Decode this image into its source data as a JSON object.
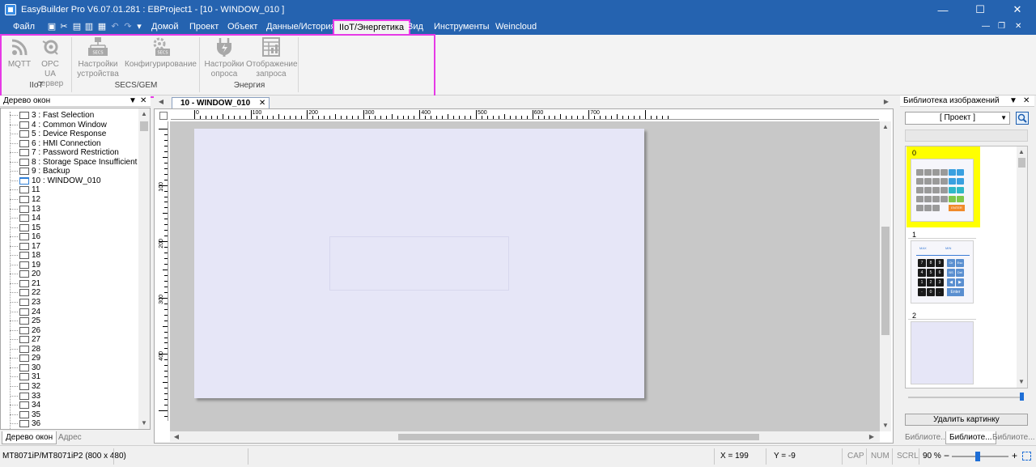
{
  "window": {
    "title": "EasyBuilder Pro V6.07.01.281 : EBProject1 - [10 - WINDOW_010 ]",
    "minimize": "—",
    "maximize": "☐",
    "close": "✕"
  },
  "menu": {
    "file": "Файл",
    "home": "Домой",
    "project": "Проект",
    "object": "Объект",
    "data_history": "Данные/История",
    "iiot_energy": "IIoT/Энергетика",
    "view": "Вид",
    "tools": "Инструменты",
    "weincloud": "Weincloud"
  },
  "ribbon": {
    "mqtt": "MQTT",
    "opcua_line1": "OPC UA",
    "opcua_line2": "сервер",
    "group_iiot": "IIoT",
    "dev_settings_line1": "Настройки",
    "dev_settings_line2": "устройства",
    "configuring": "Конфигурирование",
    "group_secs": "SECS/GEM",
    "poll_settings_line1": "Настройки",
    "poll_settings_line2": "опроса",
    "query_display_line1": "Отображение",
    "query_display_line2": "запроса",
    "group_energy": "Энергия",
    "secs_badge": "SECS"
  },
  "window_tree": {
    "title": "Дерево окон",
    "items": [
      "3 : Fast Selection",
      "4 : Common Window",
      "5 : Device Response",
      "6 : HMI Connection",
      "7 : Password Restriction",
      "8 : Storage Space Insufficient",
      "9 : Backup",
      "10 : WINDOW_010",
      "11",
      "12",
      "13",
      "14",
      "15",
      "16",
      "17",
      "18",
      "19",
      "20",
      "21",
      "22",
      "23",
      "24",
      "25",
      "26",
      "27",
      "28",
      "29",
      "30",
      "31",
      "32",
      "33",
      "34",
      "35",
      "36"
    ],
    "tab_tree": "Дерево окон",
    "tab_address": "Адрес"
  },
  "document": {
    "tab": "10 - WINDOW_010",
    "ruler_h": [
      "0",
      "100",
      "200",
      "300",
      "400",
      "500",
      "600",
      "700"
    ],
    "ruler_v": [
      "100",
      "200",
      "300",
      "400"
    ]
  },
  "library": {
    "title": "Библиотека изображений",
    "combo": "[ Проект ]",
    "items": [
      "0",
      "1",
      "2"
    ],
    "delete_button": "Удалить картинку",
    "tabs": [
      "Библиоте...",
      "Библиоте...",
      "Библиоте..."
    ],
    "keypad0_enter": "ENTER",
    "keypad1_enter": "Enter",
    "keypad1_header": [
      "MAX",
      "MIN"
    ],
    "keypad1_keys": [
      "7",
      "8",
      "9",
      "0",
      "4",
      "5",
      "6",
      "1",
      "2",
      "3",
      "-",
      "0",
      "."
    ],
    "keypad1_side": [
      "Clr",
      "Esc",
      "BS",
      "Del"
    ]
  },
  "status": {
    "model": "MT8071iP/MT8071iP2 (800 x 480)",
    "x": "X = 199",
    "y": "Y = -9",
    "cap": "CAP",
    "num": "NUM",
    "scrl": "SCRL",
    "zoom": "90 %",
    "zoom_minus": "−",
    "zoom_plus": "+"
  },
  "colors": {
    "titlebar": "#2563b0",
    "highlight": "#e63ae6",
    "page": "#e6e6f7",
    "selected_item": "#ffff00"
  }
}
